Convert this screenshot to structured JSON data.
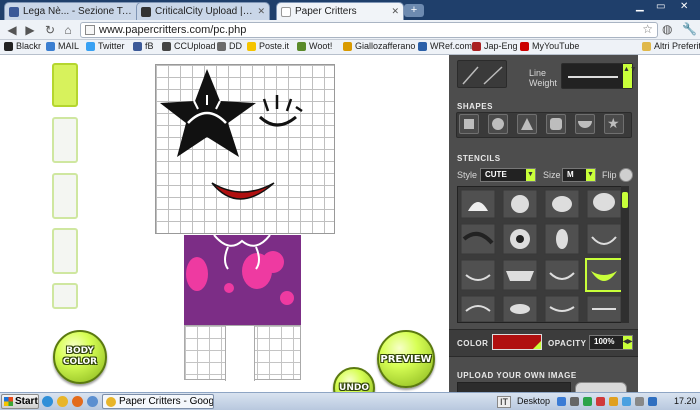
{
  "browser": {
    "tabs": [
      {
        "label": "Lega Nè... - Sezione Torino",
        "favicon_color": "#3b5998",
        "active": false
      },
      {
        "label": "CriticalCity Upload | Dashb...",
        "favicon_color": "#333333",
        "active": false
      },
      {
        "label": "Paper Critters",
        "favicon_color": "#ffffff",
        "active": true
      }
    ],
    "new_tab_label": "+",
    "url": "www.papercritters.com/pc.php",
    "bookmarks": [
      {
        "label": "Blackr",
        "icon_color": "#222222"
      },
      {
        "label": "MAIL",
        "icon_color": "#3b7fd1"
      },
      {
        "label": "Twitter",
        "icon_color": "#38a1f3"
      },
      {
        "label": "fB",
        "icon_color": "#3b5998"
      },
      {
        "label": "CCUpload",
        "icon_color": "#444444"
      },
      {
        "label": "DD",
        "icon_color": "#6a6a6a"
      },
      {
        "label": "Poste.it",
        "icon_color": "#f5c400"
      },
      {
        "label": "Woot!",
        "icon_color": "#5a8a2a"
      },
      {
        "label": "Giallozafferano",
        "icon_color": "#d99a00"
      },
      {
        "label": "WRef.com",
        "icon_color": "#2a5fa8"
      },
      {
        "label": "Jap-Eng",
        "icon_color": "#aa2222"
      },
      {
        "label": "MyYouTube",
        "icon_color": "#cc0000"
      }
    ],
    "other_bookmarks": "Altri Preferiti"
  },
  "editor": {
    "shirt_color": "#7c2d86",
    "spot_color": "#ee3aa1",
    "accent_color": "#c8ff3a",
    "buttons": {
      "body_color": "BODY COLOR",
      "preview": "PREVIEW",
      "undo": "UNDO"
    }
  },
  "panel": {
    "line_weight_label": "Line Weight",
    "shapes_title": "SHAPES",
    "shapes": [
      "square",
      "circle",
      "triangle",
      "rounded-square",
      "half-circle",
      "star"
    ],
    "stencils_title": "STENCILS",
    "style_label": "Style",
    "style_value": "CUTE",
    "size_label": "Size",
    "size_value": "M",
    "flip_label": "Flip",
    "color_label": "COLOR",
    "color_value": "#b01010",
    "opacity_label": "OPACITY",
    "opacity_value": "100%",
    "upload_title": "UPLOAD YOUR OWN IMAGE"
  },
  "taskbar": {
    "start_label": "Start",
    "task_label": "Paper Critters - Googl...",
    "language": "IT",
    "desktop_label": "Desktop",
    "clock": "17.20"
  }
}
